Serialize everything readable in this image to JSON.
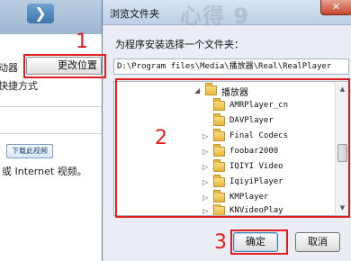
{
  "installer": {
    "player_label": "动器",
    "change_location_button": "更改位置",
    "shortcut_label": "快捷方式",
    "download_video_button": "下载此视频",
    "internet_video_text": "或 Internet 视频。"
  },
  "dialog": {
    "title": "浏览文件夹",
    "close_glyph": "✕",
    "instruction": "为程序安装选择一个文件夹：",
    "path": "D:\\Program files\\Media\\播放器\\Real\\RealPlayer",
    "tree": {
      "root": "播放器",
      "items": [
        "AMRPlayer_cn",
        "DAVPlayer",
        "Final Codecs",
        "foobar2000",
        "IQIYI Video",
        "IqiyiPlayer",
        "KMPlayer",
        "KNVideoPlay"
      ]
    },
    "ok_button": "确定",
    "cancel_button": "取消"
  },
  "annotations": {
    "step1": "1",
    "step2": "2",
    "step3": "3"
  },
  "watermark": "心得 9",
  "icons": {
    "folder": "folder-icon",
    "expand_arrow": "chevron-right-icon",
    "collapse_arrow": "chevron-down-icon",
    "app_logo": "app-logo-icon"
  },
  "colors": {
    "annotation_red": "#e11d1d",
    "folder_yellow": "#e6b53e"
  }
}
